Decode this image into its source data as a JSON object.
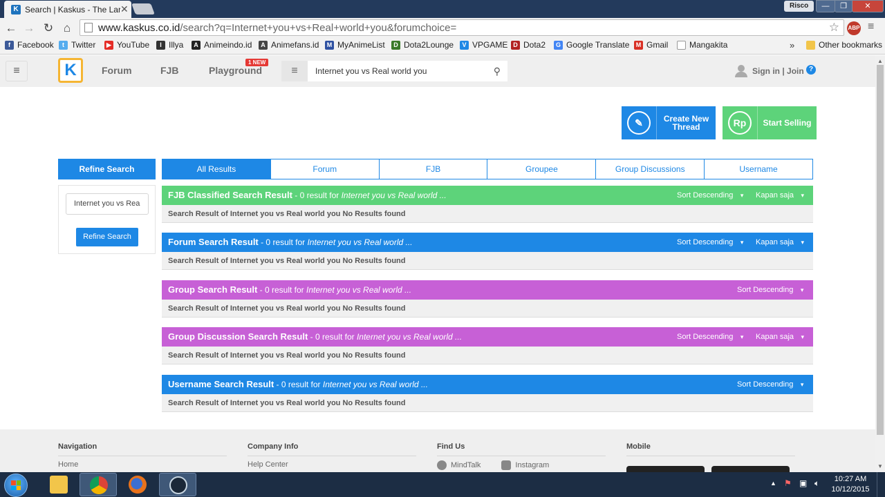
{
  "browser": {
    "tab_title": "Search | Kaskus - The Larg",
    "tab_favicon": "K",
    "tab_close": "✕",
    "user_badge": "Risco",
    "win_min": "—",
    "win_max": "❐",
    "win_close": "✕",
    "back": "←",
    "forward": "→",
    "reload": "↻",
    "home": "⌂",
    "url_host": "www.kaskus.co.id",
    "url_rest": "/search?q=Internet+you+vs+Real+world+you&forumchoice=",
    "star": "☆",
    "abp": "ABP",
    "menu": "≡"
  },
  "bookmarks": {
    "items": [
      {
        "label": "Facebook",
        "color": "#3b5998",
        "glyph": "f"
      },
      {
        "label": "Twitter",
        "color": "#55acee",
        "glyph": "t"
      },
      {
        "label": "YouTube",
        "color": "#e52d27",
        "glyph": "▶"
      },
      {
        "label": "Illya",
        "color": "#333333",
        "glyph": "I"
      },
      {
        "label": "Animeindo.id",
        "color": "#222222",
        "glyph": "A"
      },
      {
        "label": "Animefans.id",
        "color": "#444444",
        "glyph": "A"
      },
      {
        "label": "MyAnimeList",
        "color": "#2e51a2",
        "glyph": "M"
      },
      {
        "label": "Dota2Lounge",
        "color": "#3a7a2a",
        "glyph": "D"
      },
      {
        "label": "VPGAME",
        "color": "#1e88e5",
        "glyph": "V"
      },
      {
        "label": "Dota2",
        "color": "#b22222",
        "glyph": "D"
      },
      {
        "label": "Google Translate",
        "color": "#4285f4",
        "glyph": "G"
      },
      {
        "label": "Gmail",
        "color": "#d93025",
        "glyph": "M"
      },
      {
        "label": "Mangakita",
        "color": "#bbbbbb",
        "glyph": ""
      }
    ],
    "more": "»",
    "other": "Other bookmarks"
  },
  "header": {
    "menu_icon": "≡",
    "logo": "K",
    "nav": [
      "Forum",
      "FJB",
      "Playground"
    ],
    "new_badge": "1 NEW",
    "search_menu": "≡",
    "search_value": "Internet you vs Real world you",
    "search_icon": "⚲",
    "signin": "Sign in | Join",
    "help": "?"
  },
  "actions": {
    "create": "Create New Thread",
    "create_icon": "✎",
    "sell": "Start Selling",
    "sell_icon": "Rp"
  },
  "refine": {
    "title": "Refine Search",
    "input_value": "Internet you vs Rea",
    "button": "Refine Search"
  },
  "tabs": [
    "All Results",
    "Forum",
    "FJB",
    "Groupee",
    "Group Discussions",
    "Username"
  ],
  "sections": [
    {
      "title": "FJB Classified Search Result",
      "count": " - 0 result for ",
      "query": "Internet you vs Real world ...",
      "sort": "Sort Descending",
      "time": "Kapan saja",
      "color": "#5dd37a",
      "body": "Search Result of Internet you vs Real world you No Results found"
    },
    {
      "title": "Forum Search Result",
      "count": " - 0 result for ",
      "query": "Internet you vs Real world ...",
      "sort": "Sort Descending",
      "time": "Kapan saja",
      "color": "#1e88e5",
      "body": "Search Result of Internet you vs Real world you No Results found"
    },
    {
      "title": "Group Search Result",
      "count": " - 0 result for ",
      "query": "Internet you vs Real world ...",
      "sort": "Sort Descending",
      "time": "",
      "color": "#c760d6",
      "body": "Search Result of Internet you vs Real world you No Results found"
    },
    {
      "title": "Group Discussion Search Result",
      "count": " - 0 result for ",
      "query": "Internet you vs Real world ...",
      "sort": "Sort Descending",
      "time": "Kapan saja",
      "color": "#c760d6",
      "body": "Search Result of Internet you vs Real world you No Results found"
    },
    {
      "title": "Username Search Result",
      "count": " - 0 result for ",
      "query": "Internet you vs Real world ...",
      "sort": "Sort Descending",
      "time": "",
      "color": "#1e88e5",
      "body": "Search Result of Internet you vs Real world you No Results found"
    }
  ],
  "footer": {
    "navigation": "Navigation",
    "nav_item": "Home",
    "company": "Company Info",
    "company_item": "Help Center",
    "findus": "Find Us",
    "findus_items": [
      "MindTalk",
      "Instagram"
    ],
    "mobile": "Mobile"
  },
  "taskbar": {
    "time": "10:27 AM",
    "date": "10/12/2015"
  },
  "colors": {
    "kaskus_blue": "#1e88e5",
    "fjb_green": "#5dd37a",
    "group_purple": "#c760d6"
  }
}
